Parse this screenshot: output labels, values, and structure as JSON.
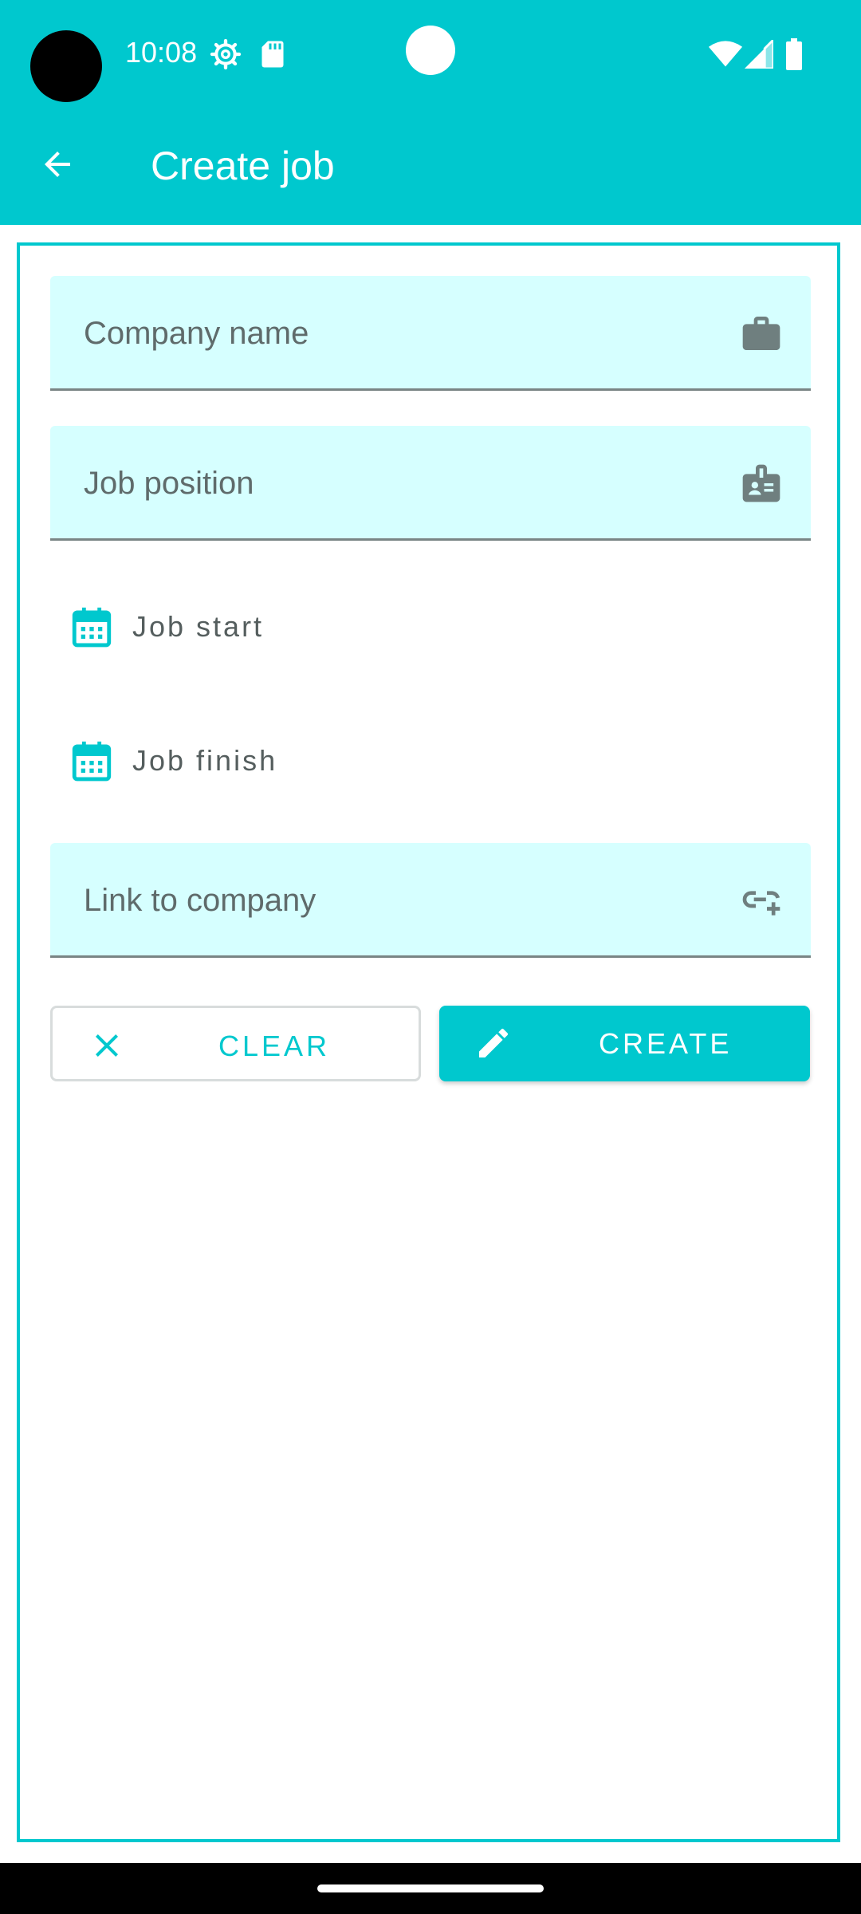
{
  "status_bar": {
    "time": "10:08",
    "icons": [
      "settings-gear-icon",
      "sd-card-icon",
      "wifi-icon",
      "cell-signal-icon",
      "battery-icon"
    ]
  },
  "toolbar": {
    "title": "Create job",
    "back_icon": "arrow-back-icon"
  },
  "form": {
    "company_name": {
      "placeholder": "Company name",
      "value": "",
      "icon": "briefcase-icon"
    },
    "job_position": {
      "placeholder": "Job position",
      "value": "",
      "icon": "badge-icon"
    },
    "job_start": {
      "label": "Job start",
      "icon": "calendar-icon"
    },
    "job_finish": {
      "label": "Job finish",
      "icon": "calendar-icon"
    },
    "company_link": {
      "placeholder": "Link to company",
      "value": "",
      "icon": "add-link-icon"
    }
  },
  "actions": {
    "clear_label": "CLEAR",
    "create_label": "CREATE"
  },
  "colors": {
    "primary": "#00C8CE",
    "field_background": "#D6FFFF",
    "field_icon": "#6f7f7f"
  }
}
